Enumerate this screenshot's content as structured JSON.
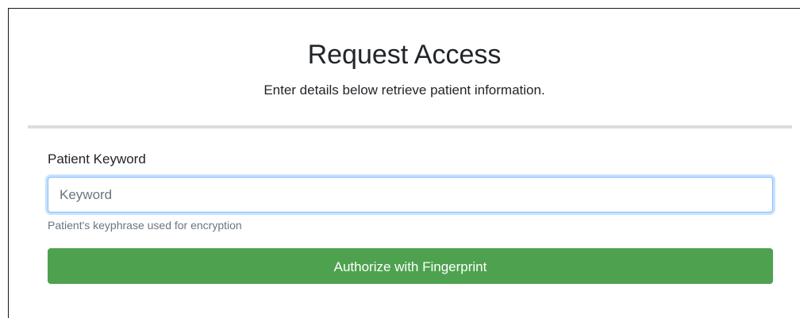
{
  "header": {
    "title": "Request Access",
    "subtitle": "Enter details below retrieve patient information."
  },
  "form": {
    "keyword": {
      "label": "Patient Keyword",
      "placeholder": "Keyword",
      "value": "",
      "help": "Patient's keyphrase used for encryption"
    },
    "authorize_button_label": "Authorize with Fingerprint"
  },
  "colors": {
    "button_background": "#4ea24f",
    "input_focus_border": "#80bdff",
    "divider": "#dcdcdc",
    "help_text": "#6c757d"
  }
}
